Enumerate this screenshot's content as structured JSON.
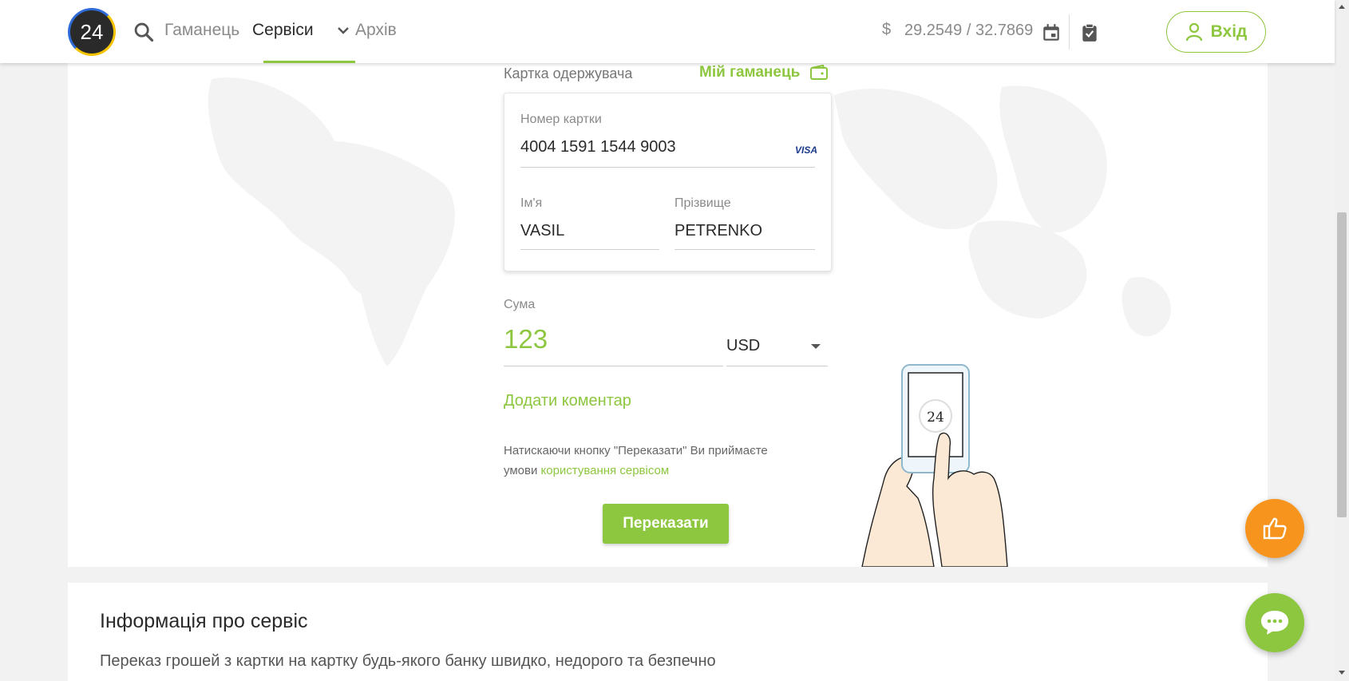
{
  "header": {
    "logo_text": "24",
    "nav": [
      {
        "label": "Гаманець"
      },
      {
        "label": "Сервіси"
      },
      {
        "label": "Архів"
      }
    ],
    "currency_symbol": "$",
    "rate": "29.2549 / 32.7869",
    "login_label": "Вхід"
  },
  "form": {
    "recipient_label": "Картка одержувача",
    "my_wallet_label": "Мій гаманець",
    "card_number_label": "Номер картки",
    "card_number_value": "4004 1591 1544 9003",
    "card_brand": "VISA",
    "first_name_label": "Ім'я",
    "first_name_value": "VASIL",
    "last_name_label": "Прізвище",
    "last_name_value": "PETRENKO",
    "sum_label": "Сума",
    "sum_value": "123",
    "currency_value": "USD",
    "add_comment_label": "Додати коментар",
    "terms_text": "Натискаючи кнопку \"Переказати\" Ви приймаєте умови ",
    "terms_link": "користування сервісом",
    "transfer_label": "Переказати",
    "phone_logo": "24"
  },
  "info": {
    "title": "Інформація про сервіс",
    "text": "Переказ грошей з картки на картку будь-якого банку швидко, недорого та безпечно"
  },
  "colors": {
    "accent": "#8dc63f",
    "orange": "#f7941d"
  }
}
